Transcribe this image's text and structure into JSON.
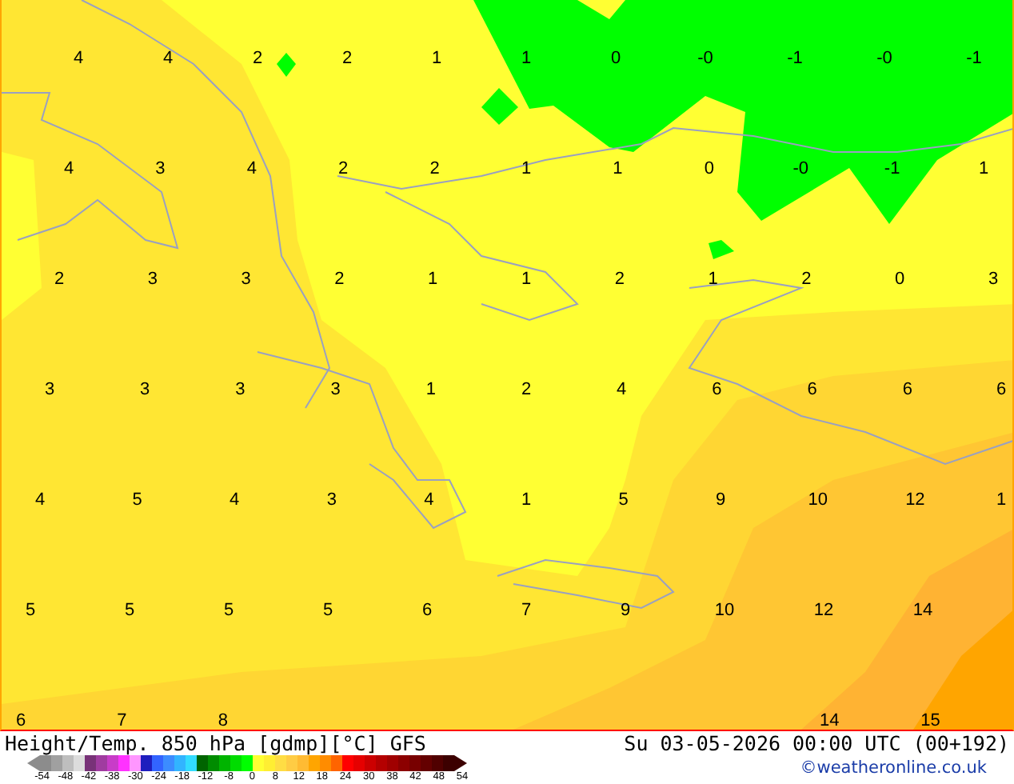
{
  "map": {
    "rows": [
      [
        "4",
        "4",
        "2",
        "2",
        "1",
        "1",
        "0",
        "-0",
        "-1",
        "-0",
        "-1"
      ],
      [
        "4",
        "3",
        "4",
        "2",
        "2",
        "1",
        "1",
        "0",
        "-0",
        "-1",
        "1"
      ],
      [
        "2",
        "3",
        "3",
        "2",
        "1",
        "1",
        "2",
        "1",
        "2",
        "0",
        "3"
      ],
      [
        "3",
        "3",
        "3",
        "3",
        "1",
        "2",
        "4",
        "6",
        "6",
        "6",
        "6"
      ],
      [
        "4",
        "5",
        "4",
        "3",
        "4",
        "1",
        "5",
        "9",
        "10",
        "12",
        "1"
      ],
      [
        "5",
        "5",
        "5",
        "5",
        "6",
        "7",
        "9",
        "10",
        "12",
        "14",
        null
      ],
      [
        "6",
        "7",
        "8",
        null,
        null,
        null,
        null,
        null,
        "14",
        "15",
        null
      ]
    ]
  },
  "footer": {
    "title": "Height/Temp. 850 hPa [gdmp][°C] GFS",
    "datetime": "Su 03-05-2026 00:00 UTC (00+192)",
    "credit": "©weatheronline.co.uk"
  },
  "legend": {
    "swatches": [
      {
        "color": "#8c8c8c"
      },
      {
        "color": "#a0a0a0"
      },
      {
        "color": "#bebebe"
      },
      {
        "color": "#dcdcdc"
      },
      {
        "color": "#783278"
      },
      {
        "color": "#a03ca0"
      },
      {
        "color": "#c83cc8"
      },
      {
        "color": "#ff32ff"
      },
      {
        "color": "#ff96ff"
      },
      {
        "color": "#1e1ebe"
      },
      {
        "color": "#3264ff"
      },
      {
        "color": "#3c8cff"
      },
      {
        "color": "#32b4ff"
      },
      {
        "color": "#32dcff"
      },
      {
        "color": "#006400"
      },
      {
        "color": "#008c00"
      },
      {
        "color": "#00b400"
      },
      {
        "color": "#00dc00"
      },
      {
        "color": "#00ff00"
      },
      {
        "color": "#ffff33"
      },
      {
        "color": "#ffee33"
      },
      {
        "color": "#ffdd44"
      },
      {
        "color": "#ffcc44"
      },
      {
        "color": "#ffbb33"
      },
      {
        "color": "#ffa500"
      },
      {
        "color": "#ff8c00"
      },
      {
        "color": "#ff6400"
      },
      {
        "color": "#ff0000"
      },
      {
        "color": "#e60000"
      },
      {
        "color": "#cc0000"
      },
      {
        "color": "#b40000"
      },
      {
        "color": "#a00000"
      },
      {
        "color": "#8c0000"
      },
      {
        "color": "#780000"
      },
      {
        "color": "#640000"
      },
      {
        "color": "#500000"
      },
      {
        "color": "#3c0000"
      }
    ],
    "ticks": [
      "-54",
      "-48",
      "-42",
      "-38",
      "-30",
      "-24",
      "-18",
      "-12",
      "-8",
      "0",
      "8",
      "12",
      "18",
      "24",
      "30",
      "38",
      "42",
      "48",
      "54"
    ]
  }
}
